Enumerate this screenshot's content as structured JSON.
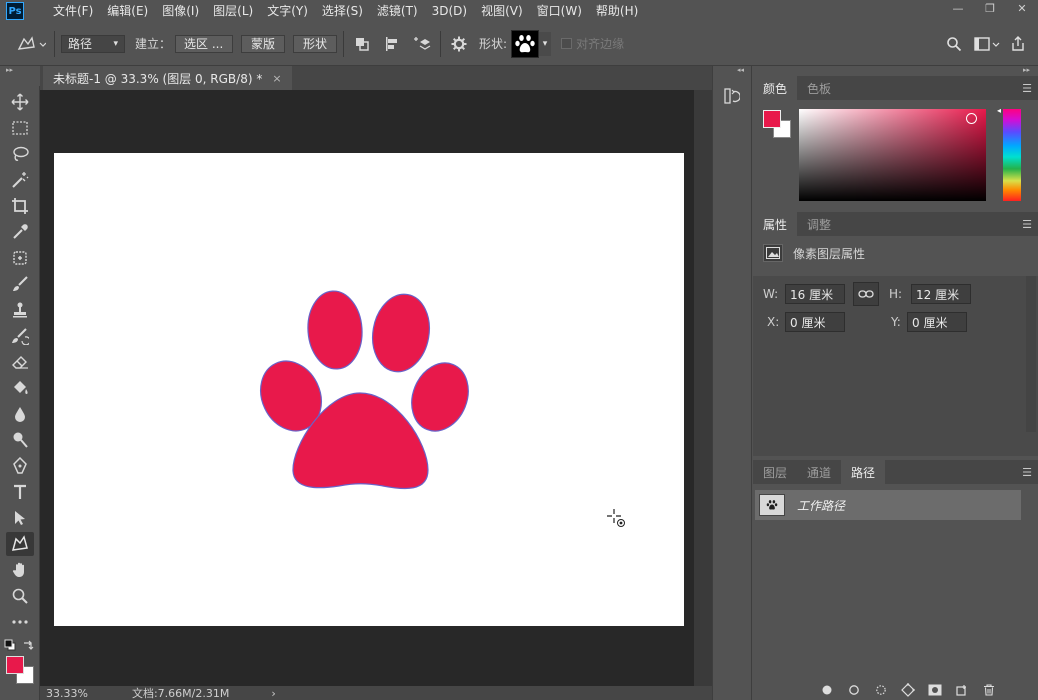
{
  "app": {
    "logo": "Ps"
  },
  "menu": [
    "文件(F)",
    "编辑(E)",
    "图像(I)",
    "图层(L)",
    "文字(Y)",
    "选择(S)",
    "滤镜(T)",
    "3D(D)",
    "视图(V)",
    "窗口(W)",
    "帮助(H)"
  ],
  "window_controls": {
    "minimize": "—",
    "restore": "❐",
    "close": "✕"
  },
  "options": {
    "mode_value": "路径",
    "make_label": "建立：",
    "selection_btn": "选区 ...",
    "mask_btn": "蒙版",
    "shape_btn": "形状",
    "shape_label": "形状:",
    "align_edges_label": "对齐边缘"
  },
  "document": {
    "tab_title": "未标题-1 @ 33.3% (图层 0, RGB/8) *",
    "close": "×"
  },
  "status": {
    "zoom": "33.33%",
    "doc_info": "文档:7.66M/2.31M",
    "arrow": "›"
  },
  "colors": {
    "foreground": "#e8194b",
    "background": "#ffffff",
    "paw": "#e8194b",
    "paw_outline": "#6a62c8"
  },
  "color_panel": {
    "tabs": [
      "颜色",
      "色板"
    ],
    "active": 0
  },
  "properties_panel": {
    "tabs": [
      "属性",
      "调整"
    ],
    "active": 0,
    "title": "像素图层属性",
    "w_label": "W:",
    "w_value": "16 厘米",
    "h_label": "H:",
    "h_value": "12 厘米",
    "x_label": "X:",
    "x_value": "0 厘米",
    "y_label": "Y:",
    "y_value": "0 厘米"
  },
  "paths_panel": {
    "tabs": [
      "图层",
      "通道",
      "路径"
    ],
    "active": 2,
    "path_name": "工作路径"
  }
}
